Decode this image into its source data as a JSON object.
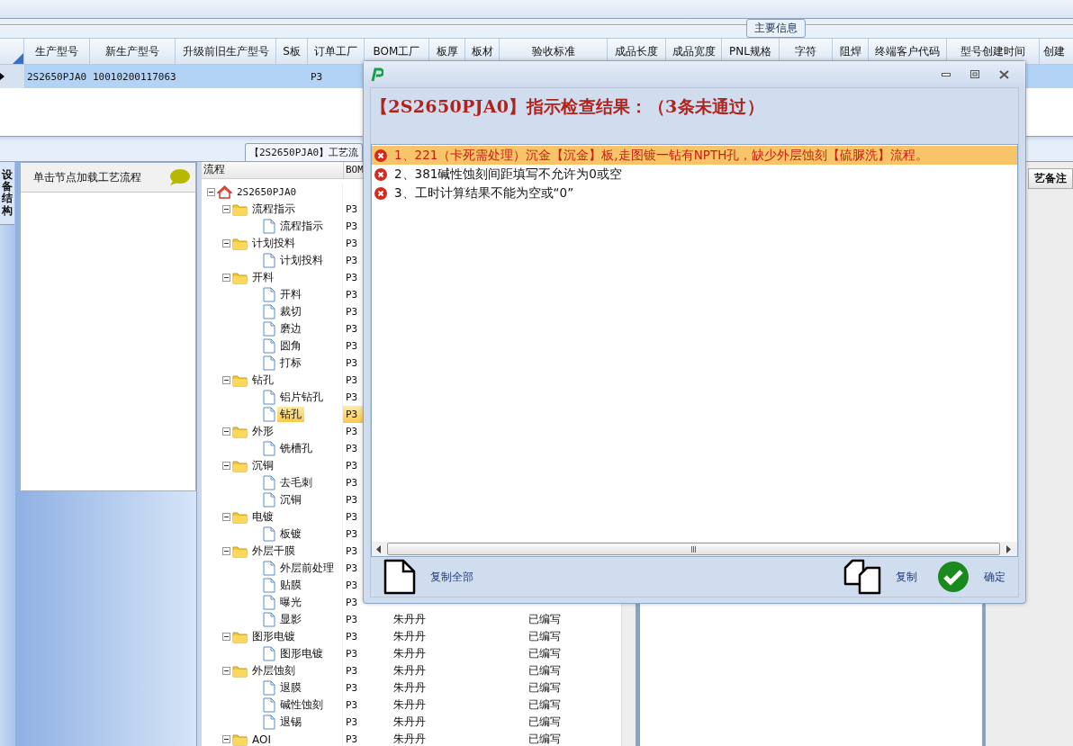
{
  "group_label": "主要信息",
  "grid": {
    "columns": [
      "生产型号",
      "新生产型号",
      "升级前旧生产型号",
      "S板",
      "订单工厂",
      "BOM工厂",
      "板厚",
      "板材",
      "验收标准",
      "成品长度",
      "成品宽度",
      "PNL规格",
      "字符",
      "阻焊",
      "终端客户代码",
      "型号创建时间",
      "创建"
    ],
    "rows": [
      {
        "selected": true,
        "current": true,
        "cells": [
          "2S2650PJA0",
          "10010200117063",
          null,
          null,
          "P3",
          null,
          null,
          null,
          null,
          null,
          null,
          null,
          null,
          null,
          null,
          null,
          null
        ]
      }
    ]
  },
  "process_tab": {
    "label": "【2S2650PJA0】工艺流"
  },
  "side_tab": {
    "label": "设备结构"
  },
  "left_panel": {
    "hint": "单击节点加载工艺流程"
  },
  "tree_columns": [
    "流程",
    "BOM"
  ],
  "tree": {
    "label": "2S2650PJA0",
    "selected": false,
    "expanded": true,
    "children": [
      {
        "label": "流程指示",
        "bom": "P3",
        "selected": false,
        "expanded": true,
        "children": [
          {
            "label": "流程指示",
            "bom": "P3",
            "selected": false
          }
        ]
      },
      {
        "label": "计划投料",
        "bom": "P3",
        "selected": false,
        "expanded": true,
        "children": [
          {
            "label": "计划投料",
            "bom": "P3",
            "selected": false
          }
        ]
      },
      {
        "label": "开料",
        "bom": "P3",
        "selected": false,
        "expanded": true,
        "children": [
          {
            "label": "开料",
            "bom": "P3",
            "selected": false
          },
          {
            "label": "裁切",
            "bom": "P3",
            "selected": false
          },
          {
            "label": "磨边",
            "bom": "P3",
            "selected": false
          },
          {
            "label": "圆角",
            "bom": "P3",
            "selected": false
          },
          {
            "label": "打标",
            "bom": "P3",
            "selected": false
          }
        ]
      },
      {
        "label": "钻孔",
        "bom": "P3",
        "selected": false,
        "expanded": true,
        "children": [
          {
            "label": "铝片钻孔",
            "bom": "P3",
            "selected": false
          },
          {
            "label": "钻孔",
            "bom": "P3",
            "selected": true
          }
        ]
      },
      {
        "label": "外形",
        "bom": "P3",
        "selected": false,
        "expanded": true,
        "children": [
          {
            "label": "铣槽孔",
            "bom": "P3",
            "selected": false
          }
        ]
      },
      {
        "label": "沉铜",
        "bom": "P3",
        "selected": false,
        "expanded": true,
        "children": [
          {
            "label": "去毛刺",
            "bom": "P3",
            "selected": false
          },
          {
            "label": "沉铜",
            "bom": "P3",
            "selected": false
          }
        ]
      },
      {
        "label": "电镀",
        "bom": "P3",
        "selected": false,
        "expanded": true,
        "children": [
          {
            "label": "板镀",
            "bom": "P3",
            "selected": false
          }
        ]
      },
      {
        "label": "外层干膜",
        "bom": "P3",
        "selected": false,
        "expanded": true,
        "children": [
          {
            "label": "外层前处理",
            "bom": "P3",
            "selected": false
          },
          {
            "label": "贴膜",
            "bom": "P3",
            "selected": false
          },
          {
            "label": "曝光",
            "bom": "P3",
            "selected": false
          },
          {
            "label": "显影",
            "bom": "P3",
            "selected": false,
            "operator": "朱丹丹",
            "status": "已编写"
          }
        ]
      },
      {
        "label": "图形电镀",
        "bom": "P3",
        "selected": false,
        "expanded": true,
        "operator": "朱丹丹",
        "status": "已编写",
        "children": [
          {
            "label": "图形电镀",
            "bom": "P3",
            "selected": false,
            "operator": "朱丹丹",
            "status": "已编写"
          }
        ]
      },
      {
        "label": "外层蚀刻",
        "bom": "P3",
        "selected": false,
        "expanded": true,
        "operator": "朱丹丹",
        "status": "已编写",
        "children": [
          {
            "label": "退膜",
            "bom": "P3",
            "selected": false,
            "operator": "朱丹丹",
            "status": "已编写"
          },
          {
            "label": "碱性蚀刻",
            "bom": "P3",
            "selected": false,
            "operator": "朱丹丹",
            "status": "已编写"
          },
          {
            "label": "退锡",
            "bom": "P3",
            "selected": false,
            "operator": "朱丹丹",
            "status": "已编写"
          }
        ]
      },
      {
        "label": "AOI",
        "bom": "P3",
        "selected": false,
        "expanded": true,
        "operator": "朱丹丹",
        "status": "已编写"
      }
    ]
  },
  "remark_header": "艺备注",
  "dialog": {
    "heading": "【2S2650PJA0】指示检查结果：（3条未通过）",
    "items": [
      {
        "text": "1、221（卡死需处理）沉金【沉金】板,走图镀一钻有NPTH孔，缺少外层蚀刻【硫脲洗】流程。",
        "selected": true
      },
      {
        "text": "2、381碱性蚀刻间距填写不允许为0或空",
        "selected": false
      },
      {
        "text": "3、工时计算结果不能为空或“0”",
        "selected": false
      }
    ],
    "buttons": [
      {
        "kind": "copy_all",
        "label": "复制全部"
      },
      {
        "kind": "copy",
        "label": "复制"
      },
      {
        "kind": "ok",
        "label": "确定"
      }
    ]
  }
}
